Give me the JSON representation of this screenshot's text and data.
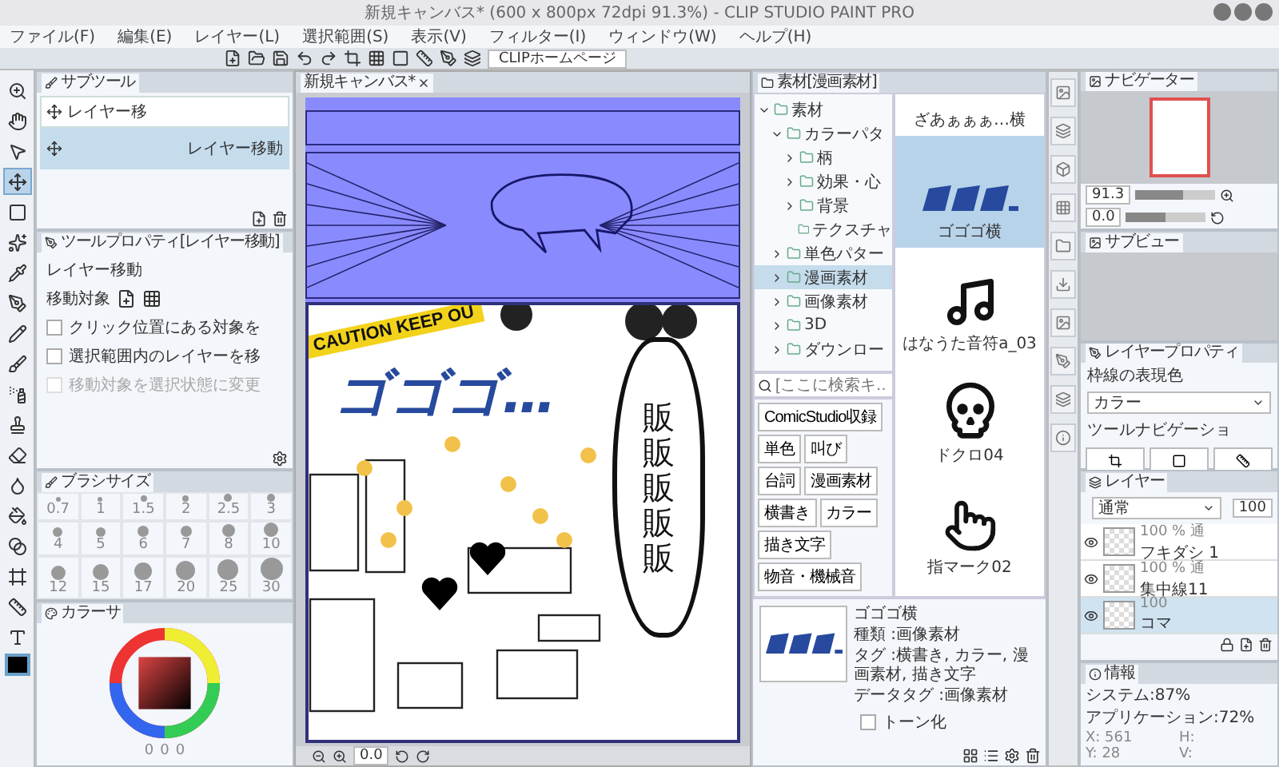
{
  "window": {
    "title": "新規キャンバス* (600 x 800px 72dpi 91.3%) - CLIP STUDIO PAINT PRO"
  },
  "menu": [
    "ファイル(F)",
    "編集(E)",
    "レイヤー(L)",
    "選択範囲(S)",
    "表示(V)",
    "フィルター(I)",
    "ウィンドウ(W)",
    "ヘルプ(H)"
  ],
  "toolbar": {
    "homepage": "CLIPホームページ"
  },
  "tools": [
    {
      "kind": "zoom",
      "selected": false
    },
    {
      "kind": "hand",
      "selected": false
    },
    {
      "kind": "object",
      "selected": false
    },
    {
      "kind": "move",
      "selected": true
    },
    {
      "kind": "marquee",
      "selected": false
    },
    {
      "kind": "wand",
      "selected": false
    },
    {
      "kind": "eyedropper",
      "selected": false
    },
    {
      "kind": "pen",
      "selected": false
    },
    {
      "kind": "pencil",
      "selected": false
    },
    {
      "kind": "brush",
      "selected": false
    },
    {
      "kind": "airbrush",
      "selected": false
    },
    {
      "kind": "decoration",
      "selected": false
    },
    {
      "kind": "eraser",
      "selected": false
    },
    {
      "kind": "blend",
      "selected": false
    },
    {
      "kind": "fill",
      "selected": false
    },
    {
      "kind": "gradient",
      "selected": false
    },
    {
      "kind": "frame",
      "selected": false
    },
    {
      "kind": "ruler",
      "selected": false
    },
    {
      "kind": "text",
      "selected": false
    }
  ],
  "subtool": {
    "tab": "サブツール",
    "group": "レイヤー移",
    "items": [
      {
        "label": "レイヤー移動",
        "selected": true
      }
    ]
  },
  "tool_property": {
    "tab": "ツールプロパティ[レイヤー移動]",
    "title": "レイヤー移動",
    "target_label": "移動対象",
    "options": [
      {
        "label": "クリック位置にある対象を",
        "checked": false,
        "disabled": false
      },
      {
        "label": "選択範囲内のレイヤーを移",
        "checked": false,
        "disabled": false
      },
      {
        "label": "移動対象を選択状態に変更",
        "checked": false,
        "disabled": true
      }
    ]
  },
  "brush_size": {
    "tab": "ブラシサイズ",
    "sizes": [
      "0.7",
      "1",
      "1.5",
      "2",
      "2.5",
      "3",
      "4",
      "5",
      "6",
      "7",
      "8",
      "10",
      "12",
      "15",
      "17",
      "20",
      "25",
      "30"
    ]
  },
  "color": {
    "tab": "カラーサ",
    "values": [
      "0",
      "0",
      "0"
    ]
  },
  "canvas": {
    "tab": "新規キャンバス*",
    "caution": "CAUTION KEEP OU",
    "sfx": "ゴゴゴ…",
    "balloon": "販販販販販",
    "rotation": "0.0"
  },
  "materials": {
    "tab": "素材[漫画素材]",
    "tree": [
      {
        "label": "素材",
        "expanded": true,
        "selected": false,
        "children": [
          {
            "label": "カラーパタ",
            "expanded": true,
            "selected": false,
            "children": [
              {
                "label": "柄",
                "expanded": false,
                "selected": false
              },
              {
                "label": "効果・心",
                "expanded": false,
                "selected": false
              },
              {
                "label": "背景",
                "expanded": false,
                "selected": false
              },
              {
                "label": "テクスチャ",
                "selected": false
              }
            ]
          },
          {
            "label": "単色パター",
            "expanded": false,
            "selected": false
          },
          {
            "label": "漫画素材",
            "expanded": false,
            "selected": true
          },
          {
            "label": "画像素材",
            "expanded": false,
            "selected": false
          },
          {
            "label": "3D",
            "expanded": false,
            "selected": false
          },
          {
            "label": "ダウンロー",
            "expanded": false,
            "selected": false
          }
        ]
      }
    ],
    "search": {
      "placeholder": "[ここに検索キ…"
    },
    "tags": [
      "ComicStudio収録",
      "単色",
      "叫び",
      "台詞",
      "漫画素材",
      "横書き",
      "カラー",
      "描き文字",
      "物音・機械音"
    ],
    "items": [
      {
        "kind": "title",
        "label": "ざあぁぁぁ…横",
        "selected": false
      },
      {
        "kind": "sfx",
        "label": "ゴゴゴ横",
        "selected": true
      },
      {
        "kind": "note",
        "label": "はなうた音符a_03",
        "selected": false
      },
      {
        "kind": "skull",
        "label": "ドクロ04",
        "selected": false
      },
      {
        "kind": "pointer",
        "label": "指マーク02",
        "selected": false
      }
    ],
    "detail": {
      "name": "ゴゴゴ横",
      "type": "種類 :画像素材",
      "tags": "タグ :横書き, カラー, 漫画素材, 描き文字",
      "data_tag": "データタグ :画像素材",
      "tone": {
        "label": "トーン化",
        "checked": false
      }
    }
  },
  "navigator": {
    "tab": "ナビゲーター",
    "zoom": {
      "reading": "91.3",
      "level": 0.6
    },
    "rotation": {
      "reading": "0.0",
      "level": 0.5
    }
  },
  "subview": {
    "tab": "サブビュー"
  },
  "layer_property": {
    "tab": "レイヤープロパティ",
    "border_label": "枠線の表現色",
    "border_color": "カラー",
    "navigation_label": "ツールナビゲーショ"
  },
  "layers": {
    "tab": "レイヤー",
    "blend": "通常",
    "opacity": "100",
    "items": [
      {
        "name": "フキダシ 1",
        "opacity": "100 %",
        "blend": "通",
        "visible": true,
        "selected": false
      },
      {
        "name": "集中線11",
        "opacity": "100 %",
        "blend": "通",
        "visible": true,
        "selected": false
      },
      {
        "name": "コマ",
        "opacity": "100",
        "visible": true,
        "selected": true
      }
    ]
  },
  "info": {
    "tab": "情報",
    "system": "システム:87%",
    "app": "アプリケーション:72%",
    "x": "X: 561",
    "y": "Y: 28",
    "h": "H:",
    "v": "V:"
  }
}
